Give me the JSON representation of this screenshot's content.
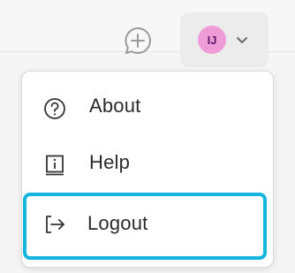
{
  "header": {
    "new_chat_icon": "chat-plus-icon",
    "avatar_initials": "IJ",
    "avatar_color": "#ef9bd8",
    "dropdown_icon": "chevron-down-icon"
  },
  "menu": {
    "items": [
      {
        "label": "About",
        "icon": "question-circle-icon"
      },
      {
        "label": "Help",
        "icon": "info-box-icon"
      },
      {
        "label": "Logout",
        "icon": "logout-arrow-icon"
      }
    ],
    "highlight_color": "#14b6df"
  }
}
